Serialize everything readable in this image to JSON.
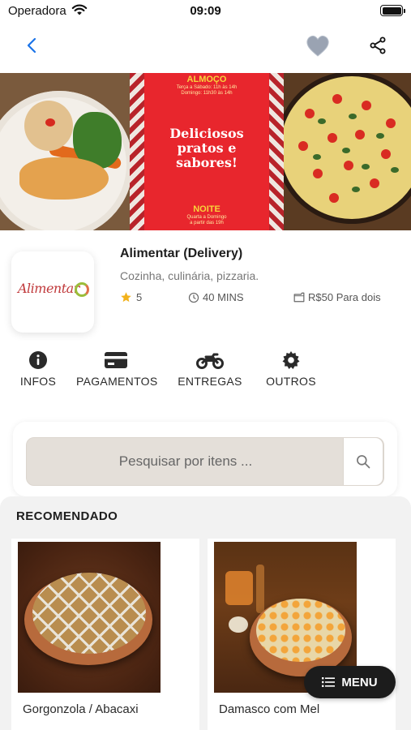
{
  "status_bar": {
    "carrier": "Operadora",
    "time": "09:09"
  },
  "nav": {
    "back_icon": "chevron-left-icon",
    "favorite_icon": "heart-icon",
    "share_icon": "share-icon",
    "accent_color": "#1a73e8"
  },
  "banner": {
    "lunch_title": "ALMOÇO",
    "lunch_hours_1": "Terça a Sábado: 11h às 14h",
    "lunch_hours_2": "Domingo: 11h30 às 14h",
    "headline": "Deliciosos pratos e sabores!",
    "night_title": "NOITE",
    "night_hours_1": "Quarta a Domingo",
    "night_hours_2": "a partir das 19h"
  },
  "restaurant": {
    "logo_text": "Alimentar",
    "name": "Alimentar (Delivery)",
    "cuisine": "Cozinha, culinária, pizzaria.",
    "rating": "5",
    "delivery_time": "40 MINS",
    "price_for_two": "R$50 Para dois",
    "star_color": "#f2b21c"
  },
  "actions": [
    {
      "label": "INFOS",
      "icon": "info-icon"
    },
    {
      "label": "PAGAMENTOS",
      "icon": "credit-card-icon"
    },
    {
      "label": "ENTREGAS",
      "icon": "motorcycle-icon"
    },
    {
      "label": "OUTROS",
      "icon": "gear-icon"
    }
  ],
  "search": {
    "placeholder": "Pesquisar por itens ...",
    "value": ""
  },
  "recommended": {
    "title": "RECOMENDADO",
    "items": [
      {
        "name": "Gorgonzola / Abacaxi"
      },
      {
        "name": "Damasco com Mel"
      }
    ]
  },
  "menu_button": {
    "label": "MENU",
    "icon": "list-icon"
  }
}
